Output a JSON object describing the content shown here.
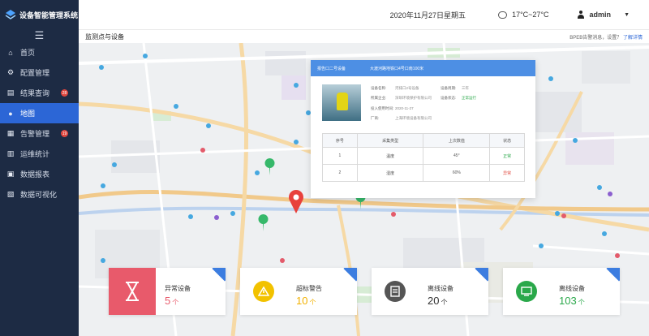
{
  "app": {
    "title": "设备智能管理系统"
  },
  "sidebar": {
    "items": [
      {
        "label": "首页",
        "icon": "home-icon"
      },
      {
        "label": "配置管理",
        "icon": "settings-icon"
      },
      {
        "label": "结果查询",
        "icon": "query-icon",
        "badge": "28"
      },
      {
        "label": "地图",
        "icon": "user-icon",
        "active": true
      },
      {
        "label": "告警管理",
        "icon": "alert-icon",
        "badge": "19"
      },
      {
        "label": "运维统计",
        "icon": "stats-icon"
      },
      {
        "label": "数据报表",
        "icon": "report-icon"
      },
      {
        "label": "数据可视化",
        "icon": "visual-icon"
      }
    ]
  },
  "header": {
    "date": "2020年11月27日星期五",
    "weather": "17°C~27°C",
    "user": "admin"
  },
  "breadcrumb": {
    "title": "监测点与设备"
  },
  "notice": {
    "text": "BPEB告警消息，设置？",
    "link": "了解详情"
  },
  "popup": {
    "header_left": "报告口二号设备",
    "header_right": "大渡河路地铁口4号口南100米",
    "info": [
      {
        "label": "设备名称:",
        "value": "河排口2号设备"
      },
      {
        "label": "设备周期:",
        "value": "三年"
      },
      {
        "label": "所属企业:",
        "value": "深圳环境保护有限公司"
      },
      {
        "label": "设备状态:",
        "value": "正常运行"
      },
      {
        "label": "投入使用时间:",
        "value": "2020-11-27"
      },
      {
        "label": "",
        "value": ""
      },
      {
        "label": "厂商:",
        "value": "上海环境设备有限公司"
      },
      {
        "label": "",
        "value": ""
      }
    ],
    "table": {
      "headers": [
        "序号",
        "采集类型",
        "上次数值",
        "状态"
      ],
      "rows": [
        [
          "1",
          "温度",
          "45°",
          "正常"
        ],
        [
          "2",
          "湿度",
          "60%",
          "异常"
        ]
      ]
    }
  },
  "cards": [
    {
      "title": "异常设备",
      "value": "5",
      "unit": "个",
      "color": "#e85a6b",
      "icon": "hourglass-icon"
    },
    {
      "title": "超标警告",
      "value": "10",
      "unit": "个",
      "color": "#f2c200",
      "icon": "warning-icon"
    },
    {
      "title": "离线设备",
      "value": "20",
      "unit": "个",
      "color": "#555555",
      "icon": "document-icon"
    },
    {
      "title": "离线设备",
      "value": "103",
      "unit": "个",
      "color": "#2aa84a",
      "icon": "screen-icon"
    }
  ],
  "colors": {
    "sidebar": "#1d2b44",
    "accent": "#2c66d6",
    "popup_header": "#4d8fe4"
  }
}
